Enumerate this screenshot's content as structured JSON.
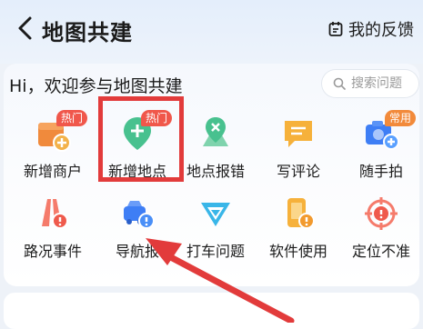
{
  "header": {
    "title": "地图共建",
    "feedback_label": "我的反馈"
  },
  "welcome": {
    "greeting": "Hi，欢迎参与地图共建",
    "search_placeholder": "搜索问题"
  },
  "grid": [
    {
      "label": "新增商户",
      "icon": "store-add-icon",
      "badge": "热门"
    },
    {
      "label": "新增地点",
      "icon": "location-add-icon",
      "badge": "热门"
    },
    {
      "label": "地点报错",
      "icon": "location-error-icon"
    },
    {
      "label": "写评论",
      "icon": "comment-icon"
    },
    {
      "label": "随手拍",
      "icon": "camera-icon",
      "badge": "常用"
    },
    {
      "label": "路况事件",
      "icon": "road-event-icon"
    },
    {
      "label": "导航报",
      "icon": "navigation-report-icon"
    },
    {
      "label": "打车问题",
      "icon": "taxi-issue-icon"
    },
    {
      "label": "软件使用",
      "icon": "app-usage-icon"
    },
    {
      "label": "定位不准",
      "icon": "locate-inaccurate-icon"
    }
  ],
  "colors": {
    "accent_red": "#e23b3b",
    "orange": "#f08a3c",
    "green": "#48c18f",
    "blue": "#3e7ef5"
  }
}
